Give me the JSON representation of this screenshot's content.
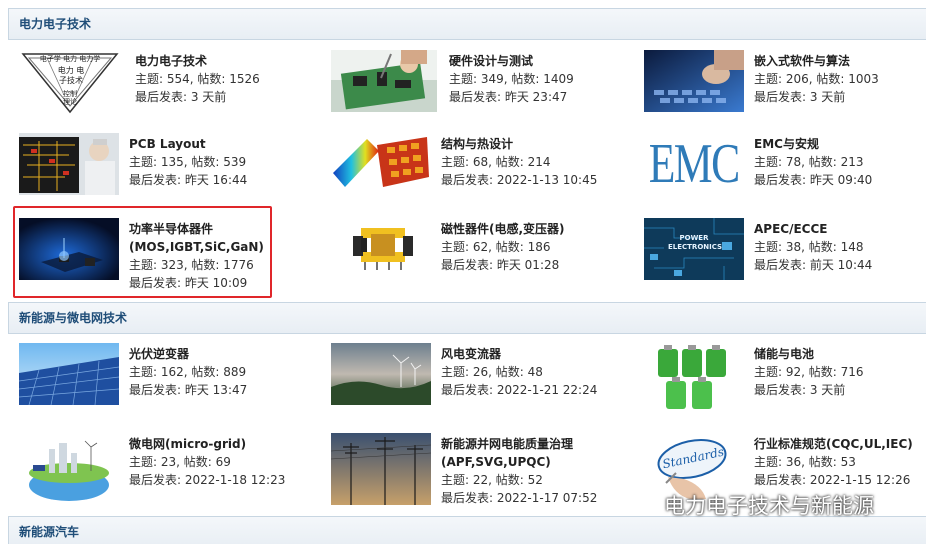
{
  "sections": [
    {
      "title": "电力电子技术"
    },
    {
      "title": "新能源与微电网技术"
    },
    {
      "title": "新能源汽车"
    }
  ],
  "forums": [
    {
      "name": "电力电子技术",
      "stats": "主题: 554, 帖数: 1526",
      "last": "最后发表: 3 天前"
    },
    {
      "name": "硬件设计与测试",
      "stats": "主题: 349, 帖数: 1409",
      "last": "最后发表: 昨天 23:47"
    },
    {
      "name": "嵌入式软件与算法",
      "stats": "主题: 206, 帖数: 1003",
      "last": "最后发表: 3 天前"
    },
    {
      "name": "PCB Layout",
      "stats": "主题: 135, 帖数: 539",
      "last": "最后发表: 昨天 16:44"
    },
    {
      "name": "结构与热设计",
      "stats": "主题: 68, 帖数: 214",
      "last": "最后发表: 2022-1-13 10:45"
    },
    {
      "name": "EMC与安规",
      "stats": "主题: 78, 帖数: 213",
      "last": "最后发表: 昨天 09:40"
    },
    {
      "name": "功率半导体器件",
      "name2": "(MOS,IGBT,SiC,GaN)",
      "stats": "主题: 323, 帖数: 1776",
      "last": "最后发表: 昨天 10:09"
    },
    {
      "name": "磁性器件(电感,变压器)",
      "stats": "主题: 62, 帖数: 186",
      "last": "最后发表: 昨天 01:28"
    },
    {
      "name": "APEC/ECCE",
      "stats": "主题: 38, 帖数: 148",
      "last": "最后发表: 前天 10:44"
    },
    {
      "name": "光伏逆变器",
      "stats": "主题: 162, 帖数: 889",
      "last": "最后发表: 昨天 13:47"
    },
    {
      "name": "风电变流器",
      "stats": "主题: 26, 帖数: 48",
      "last": "最后发表: 2022-1-21 22:24"
    },
    {
      "name": "储能与电池",
      "stats": "主题: 92, 帖数: 716",
      "last": "最后发表: 3 天前"
    },
    {
      "name": "微电网(micro-grid)",
      "stats": "主题: 23, 帖数: 69",
      "last": "最后发表: 2022-1-18 12:23"
    },
    {
      "name": "新能源并网电能质量治理",
      "name2": "(APF,SVG,UPQC)",
      "stats": "主题: 22, 帖数: 52",
      "last": "最后发表: 2022-1-17 07:52"
    },
    {
      "name": "行业标准规范(CQC,UL,IEC)",
      "stats": "主题: 36, 帖数: 53",
      "last": "最后发表: 2022-1-15 12:26"
    }
  ],
  "thumbs": {
    "pe_triangle_top": "电子学 电力 电力学",
    "pe_triangle_mid": "电力 电子技术",
    "pe_triangle_low": "控制 理论",
    "emc_text": "EMC",
    "apec_text": "POWER ELECTRONICS",
    "standards_text": "Standards"
  },
  "watermark": {
    "text": "电力电子技术与新能源"
  }
}
